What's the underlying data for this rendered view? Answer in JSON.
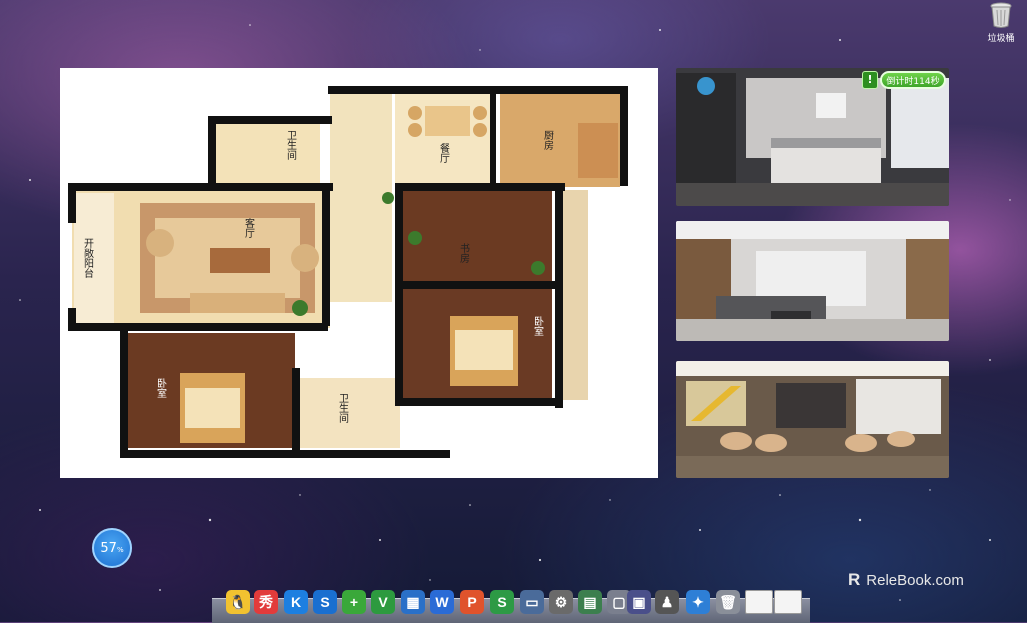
{
  "desktop": {
    "trash_label": "垃圾桶",
    "watermark": "ReleBook.com",
    "watermark_logo": "R"
  },
  "floorplan": {
    "rooms": {
      "bathroom_top": "卫生间",
      "dining": "餐厅",
      "kitchen": "厨房",
      "living": "客厅",
      "study": "书房",
      "balcony": "开敞阳台",
      "bedroom_right": "卧室",
      "bedroom_left": "卧室",
      "bathroom_bottom": "卫生间"
    }
  },
  "photos": {
    "timer_text": "倒计时114秒",
    "alert_symbol": "!"
  },
  "widget": {
    "gauge_value": "57",
    "gauge_unit": "%"
  },
  "dock": {
    "items": [
      {
        "icon": "qq-penguin-icon",
        "text": "🐧",
        "color": "#f2c230"
      },
      {
        "icon": "xiuxiu-icon",
        "text": "秀",
        "color": "#e23b3b"
      },
      {
        "icon": "kugou-icon",
        "text": "K",
        "color": "#1d7fe0"
      },
      {
        "icon": "sogou-icon",
        "text": "S",
        "color": "#1a6fd0"
      },
      {
        "icon": "plus-icon",
        "text": "+",
        "color": "#3aa83a"
      },
      {
        "icon": "shield-icon",
        "text": "V",
        "color": "#2d9a3f"
      },
      {
        "icon": "grid-icon",
        "text": "▦",
        "color": "#2a70c8"
      },
      {
        "icon": "wps-writer-icon",
        "text": "W",
        "color": "#2a6bd6"
      },
      {
        "icon": "wps-presentation-icon",
        "text": "P",
        "color": "#e0532c"
      },
      {
        "icon": "wps-sheet-icon",
        "text": "S",
        "color": "#2d9a45"
      },
      {
        "icon": "monitor-icon",
        "text": "▭",
        "color": "#4a6b9a"
      },
      {
        "icon": "gear-icon",
        "text": "⚙",
        "color": "#6a6a6a"
      },
      {
        "icon": "photo-icon",
        "text": "▤",
        "color": "#3c7f4e"
      },
      {
        "icon": "window-icon",
        "text": "▢",
        "color": "#7a7f8e"
      },
      {
        "icon": "display-icon",
        "text": "▣",
        "color": "#4a4f8a"
      },
      {
        "icon": "chess-icon",
        "text": "♟",
        "color": "#555555"
      },
      {
        "icon": "safari-compass-icon",
        "text": "✦",
        "color": "#2e7fd6"
      },
      {
        "icon": "trash-icon",
        "text": "🗑",
        "color": "#8a8f99"
      },
      {
        "icon": "document-icon",
        "text": "",
        "color": "#f4f4f4"
      },
      {
        "icon": "document-icon-2",
        "text": "",
        "color": "#f4f4f4"
      }
    ]
  }
}
